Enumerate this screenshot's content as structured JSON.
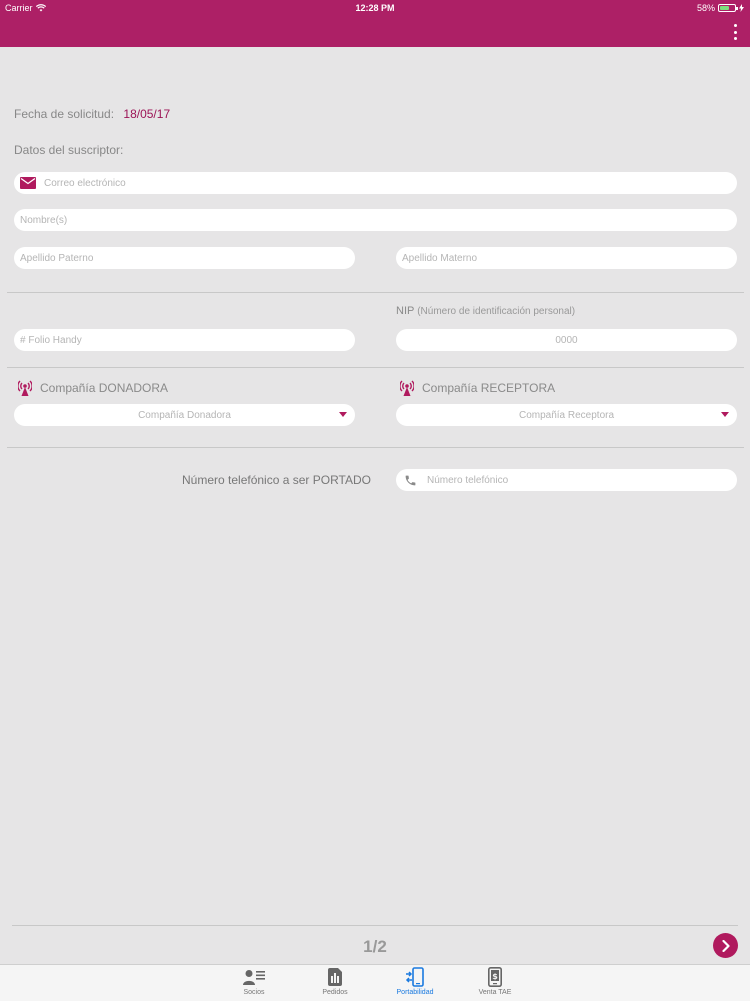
{
  "status_bar": {
    "carrier": "Carrier",
    "time": "12:28 PM",
    "battery": "58%",
    "battery_level": 0.58
  },
  "form": {
    "date_label": "Fecha de solicitud:",
    "date_value": "18/05/17",
    "subscriber_title": "Datos del suscriptor:",
    "email_placeholder": "Correo electrónico",
    "name_placeholder": "Nombre(s)",
    "paternal_placeholder": "Apellido Paterno",
    "maternal_placeholder": "Apellido Materno",
    "nip_label": "NIP",
    "nip_sub": "(Número de identificación personal)",
    "folio_placeholder": "# Folio Handy",
    "nip_value": "0000",
    "donor_label": "Compañía DONADORA",
    "donor_select": "Compañía Donadora",
    "receiver_label": "Compañía RECEPTORA",
    "receiver_select": "Compañía Receptora",
    "phone_label": "Número telefónico a ser PORTADO",
    "phone_placeholder": "Número telefónico"
  },
  "pager": {
    "page": "1/2"
  },
  "tabs": [
    {
      "label": "Socios",
      "icon": "person-list-icon",
      "active": false
    },
    {
      "label": "Pedidos",
      "icon": "sim-card-icon",
      "active": false
    },
    {
      "label": "Portabilidad",
      "icon": "phone-transfer-icon",
      "active": true
    },
    {
      "label": "Venta TAE",
      "icon": "phone-dollar-icon",
      "active": false
    }
  ],
  "colors": {
    "brand": "#ad2066",
    "accent": "#b01a5e",
    "active_tab": "#1a7ae0"
  }
}
